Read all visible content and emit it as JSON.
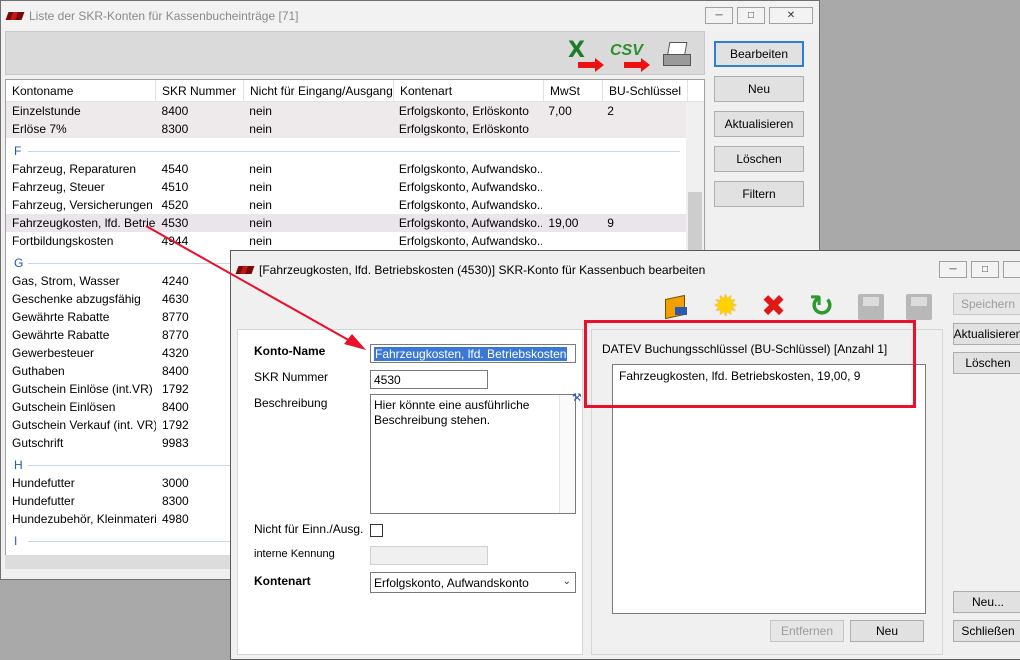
{
  "main_window": {
    "title": "Liste der SKR-Konten für Kassenbucheinträge [71]",
    "toolbar_icons": [
      "excel-export-icon",
      "csv-export-icon",
      "printer-icon"
    ],
    "columns": [
      "Kontoname",
      "SKR Nummer",
      "Nicht für Eingang/Ausgang",
      "Kontenart",
      "MwSt",
      "BU-Schlüssel"
    ],
    "rows_top": [
      {
        "name": "Einzelstunde",
        "skr": "8400",
        "nicht": "nein",
        "art": "Erfolgskonto, Erlöskonto",
        "mwst": "7,00",
        "bu": "2"
      },
      {
        "name": "Erlöse 7%",
        "skr": "8300",
        "nicht": "nein",
        "art": "Erfolgskonto, Erlöskonto",
        "mwst": "",
        "bu": ""
      }
    ],
    "group_f": "F",
    "rows_f": [
      {
        "name": "Fahrzeug, Reparaturen",
        "skr": "4540",
        "nicht": "nein",
        "art": "Erfolgskonto, Aufwandsko...",
        "mwst": "",
        "bu": ""
      },
      {
        "name": "Fahrzeug, Steuer",
        "skr": "4510",
        "nicht": "nein",
        "art": "Erfolgskonto, Aufwandsko...",
        "mwst": "",
        "bu": ""
      },
      {
        "name": "Fahrzeug, Versicherungen",
        "skr": "4520",
        "nicht": "nein",
        "art": "Erfolgskonto, Aufwandsko...",
        "mwst": "",
        "bu": ""
      },
      {
        "name": "Fahrzeugkosten, lfd. Betrieb...",
        "skr": "4530",
        "nicht": "nein",
        "art": "Erfolgskonto, Aufwandsko...",
        "mwst": "19,00",
        "bu": "9"
      },
      {
        "name": "Fortbildungskosten",
        "skr": "4944",
        "nicht": "nein",
        "art": "Erfolgskonto, Aufwandsko...",
        "mwst": "",
        "bu": ""
      }
    ],
    "group_g": "G",
    "rows_g": [
      {
        "name": "Gas, Strom, Wasser",
        "skr": "4240"
      },
      {
        "name": "Geschenke abzugsfähig",
        "skr": "4630"
      },
      {
        "name": "Gewährte Rabatte",
        "skr": "8770"
      },
      {
        "name": "Gewährte Rabatte",
        "skr": "8770"
      },
      {
        "name": "Gewerbesteuer",
        "skr": "4320"
      },
      {
        "name": "Guthaben",
        "skr": "8400"
      },
      {
        "name": "Gutschein Einlöse (int.VR)",
        "skr": "1792"
      },
      {
        "name": "Gutschein Einlösen",
        "skr": "8400"
      },
      {
        "name": "Gutschein Verkauf (int. VR)",
        "skr": "1792"
      },
      {
        "name": "Gutschrift",
        "skr": "9983"
      }
    ],
    "group_h": "H",
    "rows_h": [
      {
        "name": "Hundefutter",
        "skr": "3000"
      },
      {
        "name": "Hundefutter",
        "skr": "8300"
      },
      {
        "name": "Hundezubehör, Kleinmaterial",
        "skr": "4980"
      }
    ],
    "group_i": "I",
    "buttons": {
      "bearbeiten": "Bearbeiten",
      "neu": "Neu",
      "aktualisieren": "Aktualisieren",
      "loeschen": "Löschen",
      "filtern": "Filtern"
    }
  },
  "dialog": {
    "title": "[Fahrzeugkosten, lfd. Betriebskosten (4530)] SKR-Konto für Kassenbuch bearbeiten",
    "form": {
      "konto_name_label": "Konto-Name",
      "konto_name_value": "Fahrzeugkosten, lfd. Betriebskosten",
      "skr_label": "SKR Nummer",
      "skr_value": "4530",
      "beschreibung_label": "Beschreibung",
      "beschreibung_line1": "Hier könnte eine ausführliche",
      "beschreibung_line2": "Beschreibung stehen.",
      "nicht_label": "Nicht für Einn./Ausg.",
      "nicht_checked": false,
      "kennung_label": "interne Kennung",
      "kennung_value": "",
      "kontenart_label": "Kontenart",
      "kontenart_value": "Erfolgskonto, Aufwandskonto"
    },
    "datev": {
      "title": "DATEV Buchungsschlüssel (BU-Schlüssel) [Anzahl 1]",
      "item": "Fahrzeugkosten, lfd. Betriebskosten, 19,00, 9",
      "entfernen": "Entfernen",
      "neu": "Neu"
    },
    "right_buttons": {
      "speichern": "Speichern",
      "aktualisieren": "Aktualisieren",
      "loeschen": "Löschen",
      "neu": "Neu...",
      "schliessen": "Schließen"
    },
    "highlight_color": "#e8102a"
  }
}
